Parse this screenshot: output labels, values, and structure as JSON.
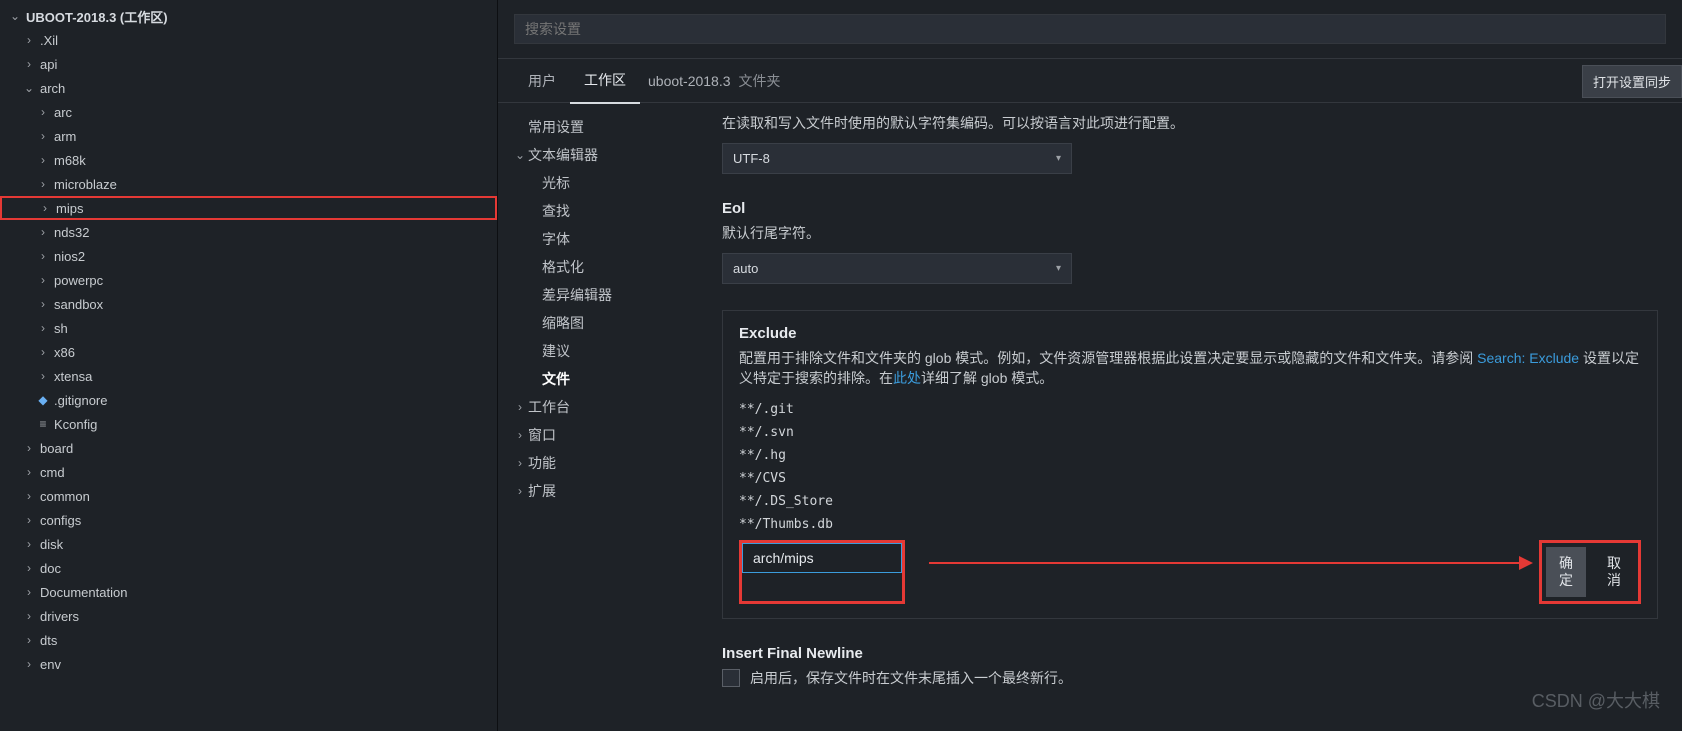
{
  "tree": {
    "root_label": "UBOOT-2018.3 (工作区)",
    "items": [
      {
        "label": ".Xil",
        "depth": 1,
        "chev": "›"
      },
      {
        "label": "api",
        "depth": 1,
        "chev": "›"
      },
      {
        "label": "arch",
        "depth": 1,
        "chev": "⌄",
        "open": true
      },
      {
        "label": "arc",
        "depth": 2,
        "chev": "›"
      },
      {
        "label": "arm",
        "depth": 2,
        "chev": "›"
      },
      {
        "label": "m68k",
        "depth": 2,
        "chev": "›"
      },
      {
        "label": "microblaze",
        "depth": 2,
        "chev": "›"
      },
      {
        "label": "mips",
        "depth": 2,
        "chev": "›",
        "hl": true
      },
      {
        "label": "nds32",
        "depth": 2,
        "chev": "›"
      },
      {
        "label": "nios2",
        "depth": 2,
        "chev": "›"
      },
      {
        "label": "powerpc",
        "depth": 2,
        "chev": "›"
      },
      {
        "label": "sandbox",
        "depth": 2,
        "chev": "›"
      },
      {
        "label": "sh",
        "depth": 2,
        "chev": "›"
      },
      {
        "label": "x86",
        "depth": 2,
        "chev": "›"
      },
      {
        "label": "xtensa",
        "depth": 2,
        "chev": "›"
      },
      {
        "label": ".gitignore",
        "depth": 2,
        "icon": "diamond"
      },
      {
        "label": "Kconfig",
        "depth": 2,
        "icon": "lines"
      },
      {
        "label": "board",
        "depth": 1,
        "chev": "›"
      },
      {
        "label": "cmd",
        "depth": 1,
        "chev": "›"
      },
      {
        "label": "common",
        "depth": 1,
        "chev": "›"
      },
      {
        "label": "configs",
        "depth": 1,
        "chev": "›"
      },
      {
        "label": "disk",
        "depth": 1,
        "chev": "›"
      },
      {
        "label": "doc",
        "depth": 1,
        "chev": "›"
      },
      {
        "label": "Documentation",
        "depth": 1,
        "chev": "›"
      },
      {
        "label": "drivers",
        "depth": 1,
        "chev": "›"
      },
      {
        "label": "dts",
        "depth": 1,
        "chev": "›"
      },
      {
        "label": "env",
        "depth": 1,
        "chev": "›"
      }
    ]
  },
  "search": {
    "placeholder": "搜索设置"
  },
  "tabs": {
    "user": "用户",
    "workspace": "工作区",
    "folder": "uboot-2018.3",
    "folder_suffix": "文件夹",
    "sync_btn": "打开设置同步"
  },
  "outline": {
    "common": "常用设置",
    "text_editor": "文本编辑器",
    "cursor": "光标",
    "find": "查找",
    "font": "字体",
    "format": "格式化",
    "diff": "差异编辑器",
    "minimap": "缩略图",
    "suggest": "建议",
    "files": "文件",
    "workbench": "工作台",
    "window": "窗口",
    "features": "功能",
    "extensions": "扩展"
  },
  "encoding": {
    "desc": "在读取和写入文件时使用的默认字符集编码。可以按语言对此项进行配置。",
    "value": "UTF-8"
  },
  "eol": {
    "title": "Eol",
    "desc": "默认行尾字符。",
    "value": "auto"
  },
  "exclude": {
    "title": "Exclude",
    "desc_a": "配置用于排除文件和文件夹的 glob 模式。例如，文件资源管理器根据此设置决定要显示或隐藏的文件和文件夹。请参阅 ",
    "desc_link1": "Search: Exclude",
    "desc_b": " 设置以定义特定于搜索的排除。在",
    "desc_link2": "此处",
    "desc_c": "详细了解 glob 模式。",
    "patterns": [
      "**/.git",
      "**/.svn",
      "**/.hg",
      "**/CVS",
      "**/.DS_Store",
      "**/Thumbs.db"
    ],
    "input_value": "arch/mips",
    "ok": "确定",
    "cancel": "取消"
  },
  "insert_newline": {
    "title": "Insert Final Newline",
    "desc": "启用后，保存文件时在文件末尾插入一个最终新行。"
  },
  "watermark": "CSDN @大大棋"
}
